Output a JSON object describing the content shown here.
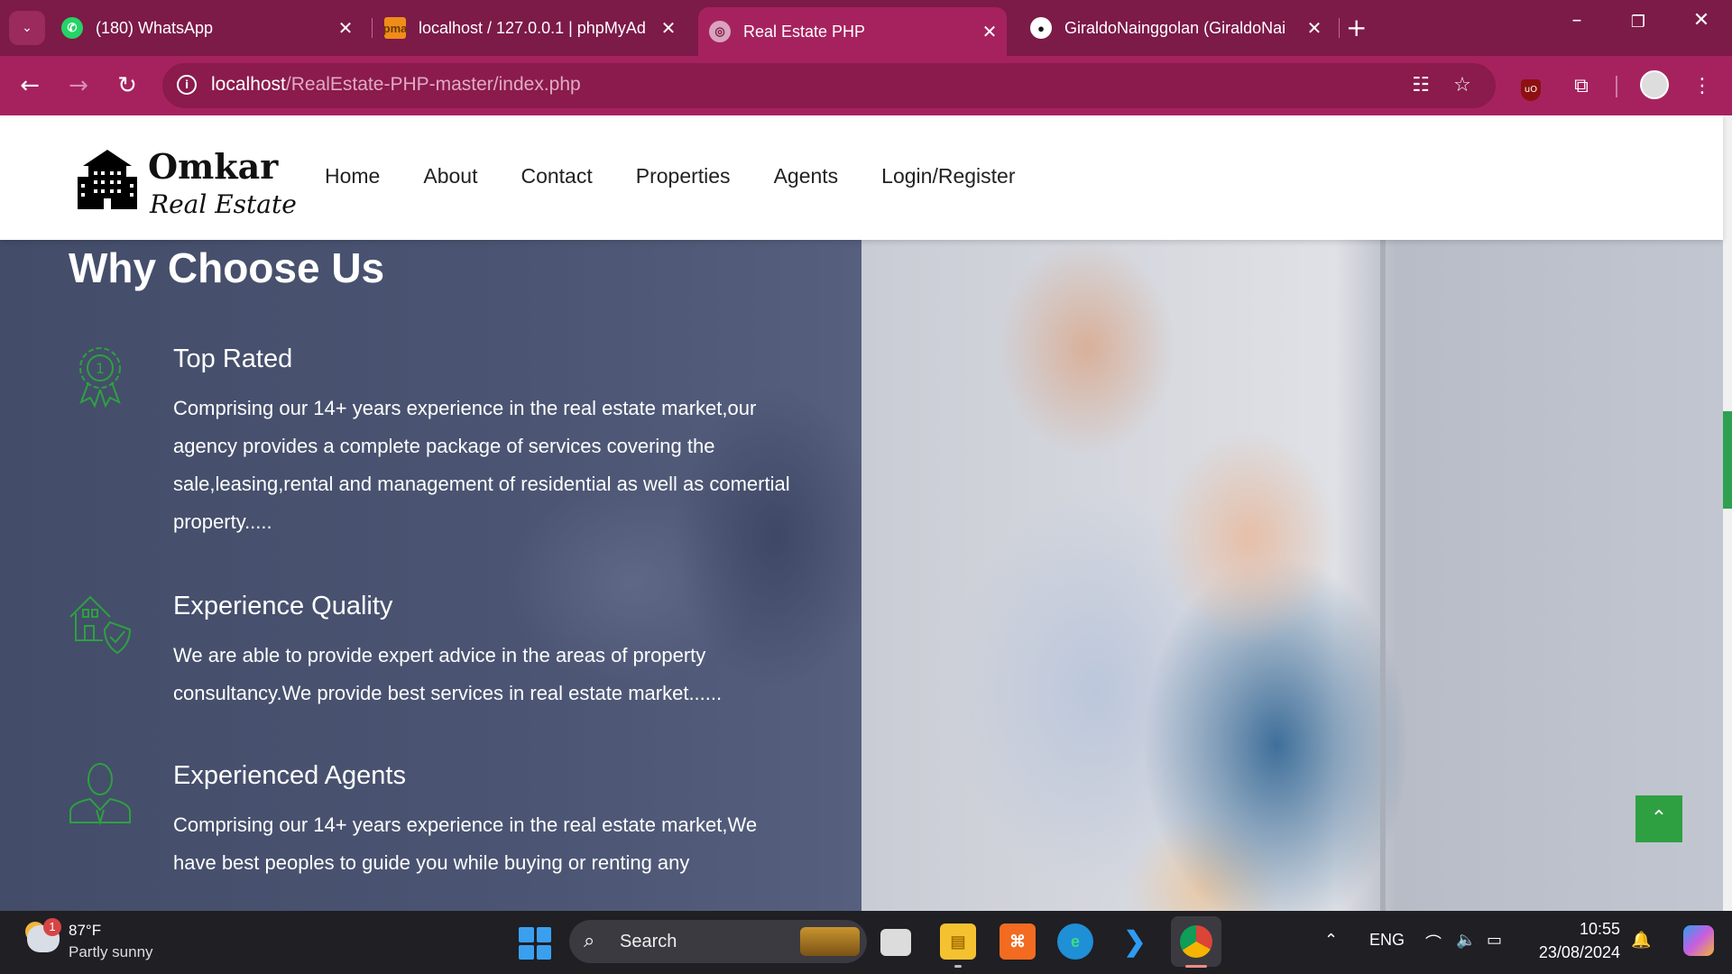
{
  "browser": {
    "tabs": [
      {
        "title": "(180) WhatsApp",
        "icon": "whatsapp-icon",
        "active": false
      },
      {
        "title": "localhost / 127.0.0.1 | phpMyAd",
        "icon": "phpmyadmin-icon",
        "active": false
      },
      {
        "title": "Real Estate PHP",
        "icon": "globe-icon",
        "active": true
      },
      {
        "title": "GiraldoNainggolan (GiraldoNai",
        "icon": "github-icon",
        "active": false
      }
    ],
    "url_host": "localhost",
    "url_path": "/RealEstate-PHP-master/index.php",
    "colors": {
      "tabbar": "#7c1a48",
      "toolbar": "#a6225f"
    }
  },
  "site": {
    "logo_name": "Omkar",
    "logo_tagline": "Real Estate",
    "nav": [
      "Home",
      "About",
      "Contact",
      "Properties",
      "Agents",
      "Login/Register"
    ]
  },
  "section": {
    "title": "Why Choose Us",
    "features": [
      {
        "icon": "award-badge-icon",
        "title": "Top Rated",
        "text": "Comprising our 14+ years experience in the real estate market,our agency provides a complete package of services covering the sale,leasing,rental and management of residential as well as comertial property....."
      },
      {
        "icon": "house-check-icon",
        "title": "Experience Quality",
        "text": "We are able to provide expert advice in the areas of property consultancy.We provide best services in real estate market......"
      },
      {
        "icon": "agent-person-icon",
        "title": "Experienced Agents",
        "text": "Comprising our 14+ years experience in the real estate market,We have best peoples to guide you while buying or renting any"
      }
    ],
    "accent_color": "#2ea041"
  },
  "taskbar": {
    "weather_temp": "87°F",
    "weather_desc": "Partly sunny",
    "weather_badge": "1",
    "search_label": "Search",
    "language": "ENG",
    "time": "10:55",
    "date": "23/08/2024"
  }
}
